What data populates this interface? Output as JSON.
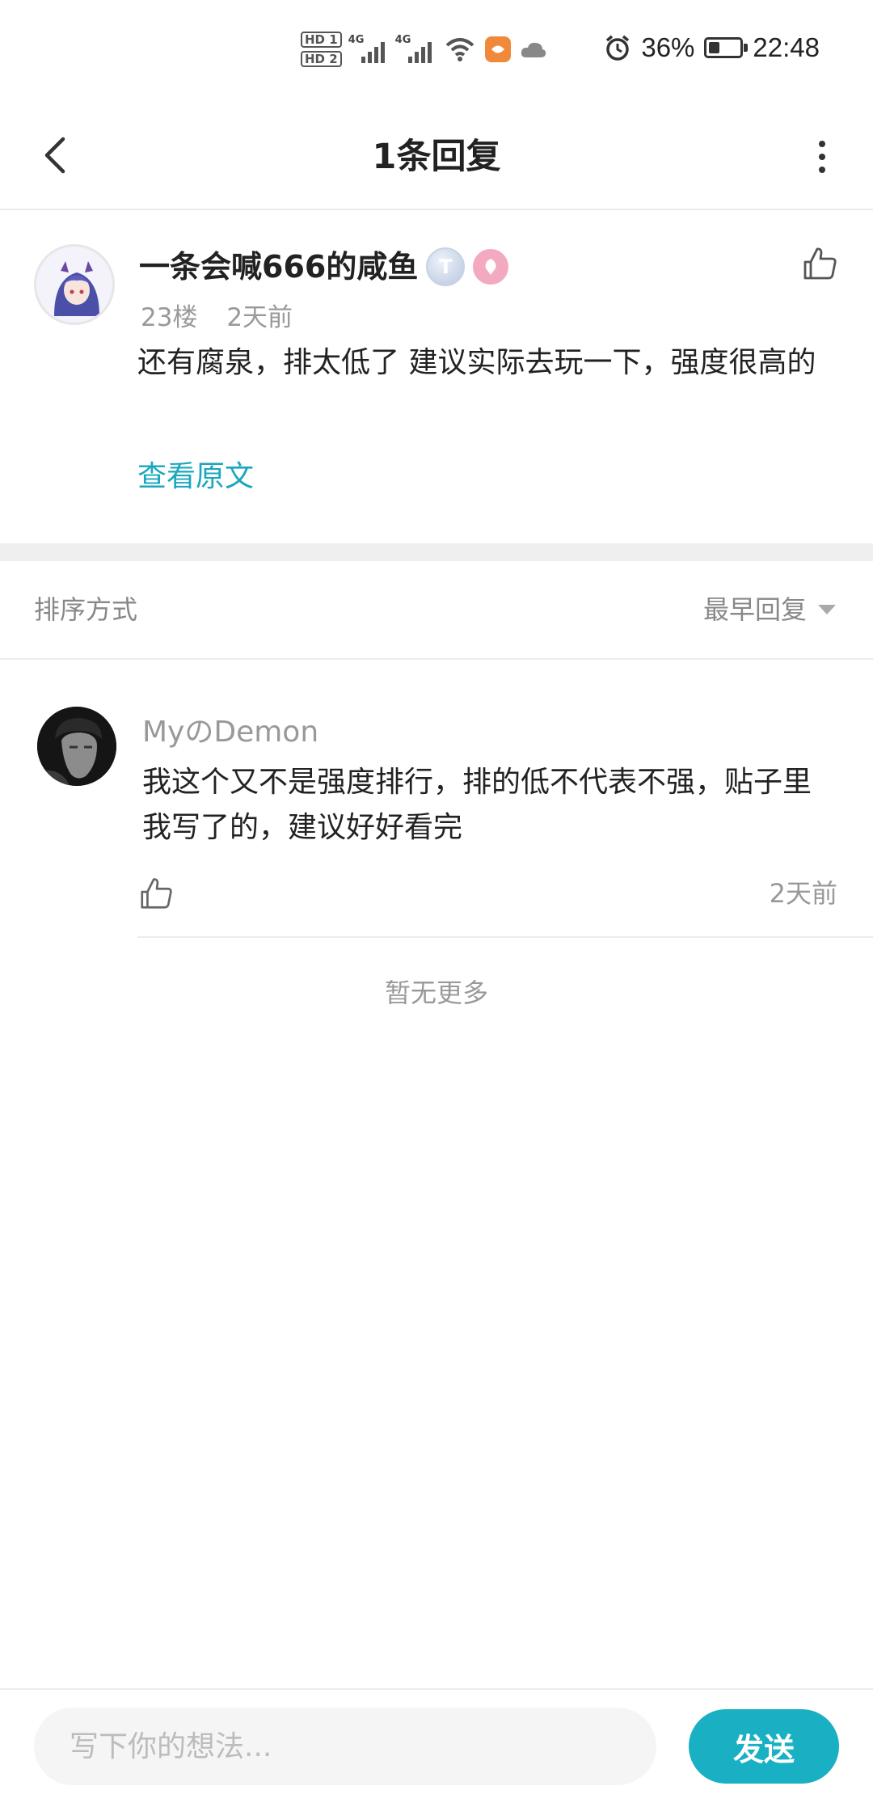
{
  "status_bar": {
    "hd1": "HD 1",
    "hd2": "HD 2",
    "net1": "4G",
    "net2": "4G",
    "battery_percent": "36%",
    "battery_level": 0.36,
    "time": "22:48",
    "icons": [
      "signal-icon",
      "wifi-icon",
      "app-notification-icon",
      "cloud-icon",
      "alarm-icon",
      "battery-icon"
    ]
  },
  "nav": {
    "title": "1条回复",
    "icons": [
      "back-chevron-icon",
      "more-vertical-icon"
    ]
  },
  "post": {
    "author": "一条会喊666的咸鱼",
    "level_badge": "T",
    "floor": "23楼",
    "time": "2天前",
    "content": "还有腐泉，排太低了 建议实际去玩一下，强度很高的",
    "view_original": "查看原文"
  },
  "sort": {
    "label": "排序方式",
    "selected": "最早回复"
  },
  "replies": [
    {
      "author": "MyのDemon",
      "content": "我这个又不是强度排行，排的低不代表不强，贴子里我写了的，建议好好看完",
      "time": "2天前"
    }
  ],
  "footer_note": "暂无更多",
  "composer": {
    "placeholder": "写下你的想法...",
    "send_label": "发送"
  },
  "colors": {
    "accent": "#1ab0c4",
    "link": "#1aa7bd",
    "muted": "#999999"
  }
}
